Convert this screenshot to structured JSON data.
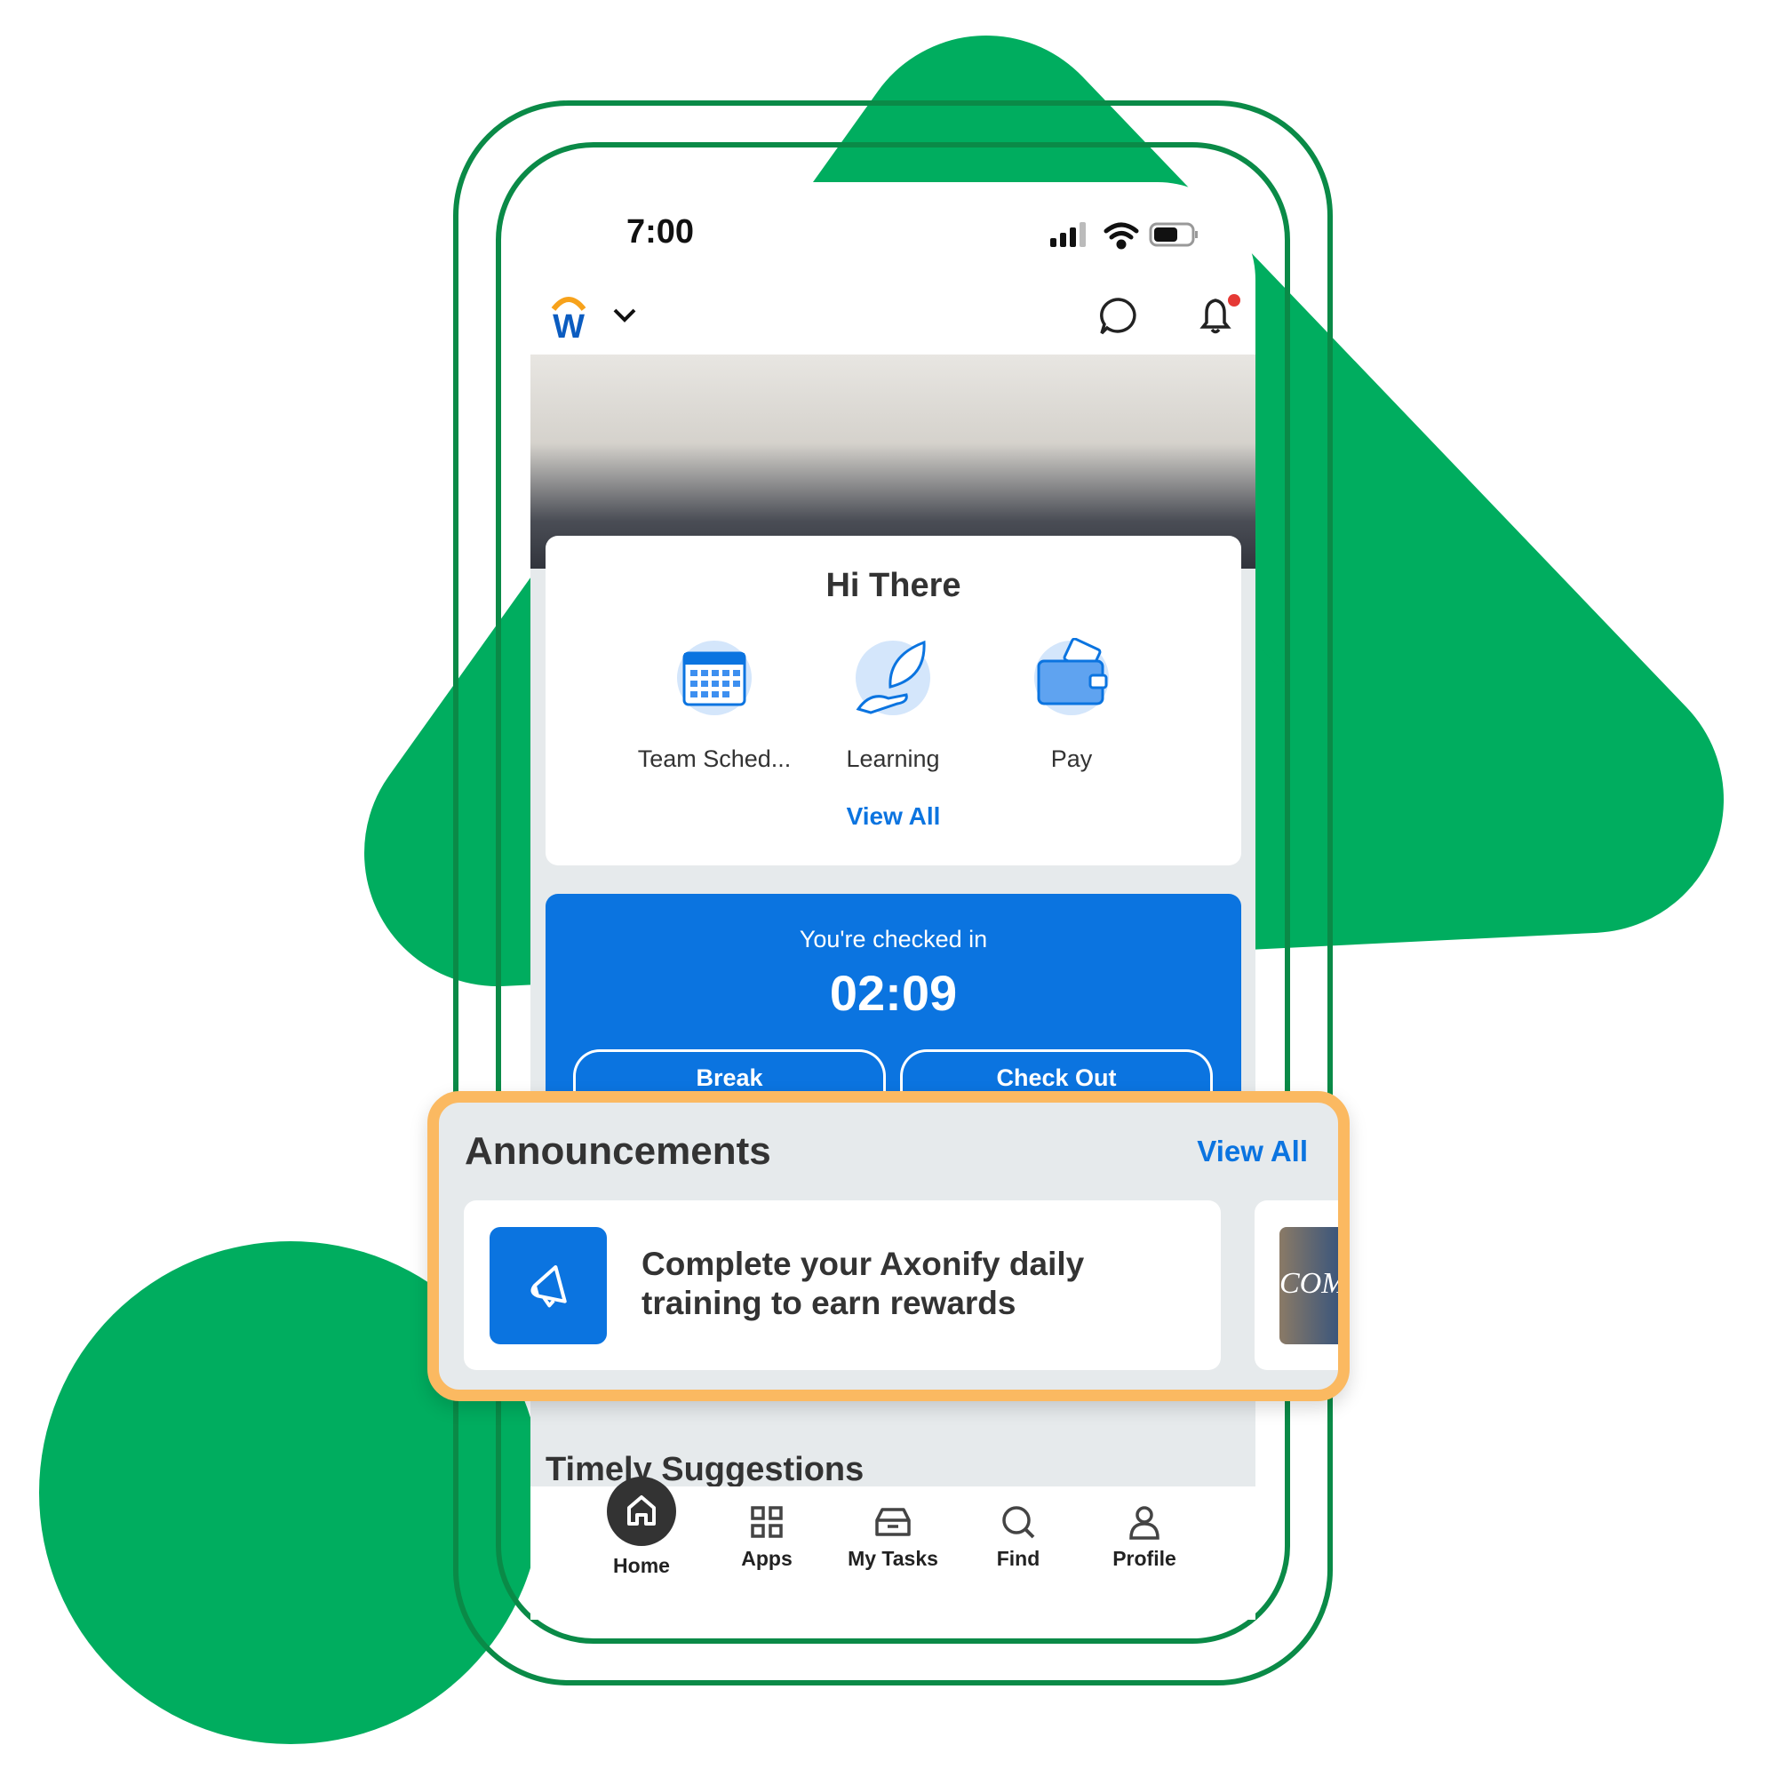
{
  "colors": {
    "brand_green": "#00ad5f",
    "frame_green": "#0a8a47",
    "accent_blue": "#0b74e0",
    "highlight_orange": "#fbb961",
    "notification_dot": "#e53935"
  },
  "status_bar": {
    "time": "7:00",
    "icons": [
      "signal-icon",
      "wifi-icon",
      "battery-icon"
    ]
  },
  "header": {
    "logo": "W",
    "icons": [
      "chevron-down-icon",
      "chat-icon",
      "bell-icon"
    ]
  },
  "welcome_card": {
    "title": "Hi There",
    "apps": [
      {
        "label": "Team Sched...",
        "icon": "calendar-icon"
      },
      {
        "label": "Learning",
        "icon": "leaf-hand-icon"
      },
      {
        "label": "Pay",
        "icon": "wallet-icon"
      }
    ],
    "view_all": "View All"
  },
  "check_in": {
    "status": "You're checked in",
    "elapsed": "02:09",
    "break_label": "Break",
    "check_out_label": "Check Out"
  },
  "announcements": {
    "title": "Announcements",
    "view_all": "View All",
    "items": [
      {
        "text": "Complete your Axonify daily training to earn rewards",
        "icon": "megaphone-icon"
      }
    ],
    "partial_item_image_text": "COME"
  },
  "timely": {
    "title": "Timely Suggestions"
  },
  "bottom_nav": {
    "items": [
      {
        "label": "Home",
        "icon": "home-icon",
        "active": true
      },
      {
        "label": "Apps",
        "icon": "grid-icon"
      },
      {
        "label": "My Tasks",
        "icon": "inbox-icon"
      },
      {
        "label": "Find",
        "icon": "search-icon"
      },
      {
        "label": "Profile",
        "icon": "person-icon"
      }
    ]
  }
}
